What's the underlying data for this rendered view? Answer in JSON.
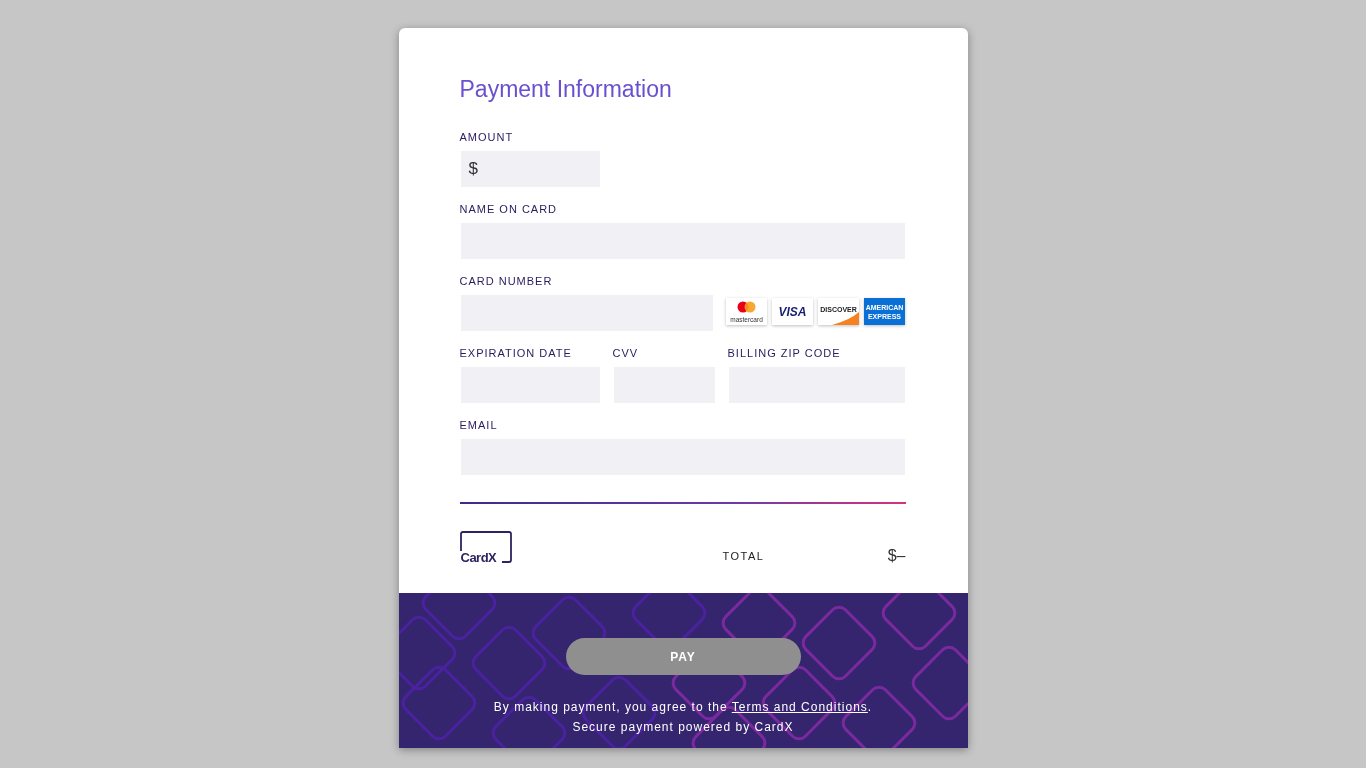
{
  "form": {
    "title": "Payment Information",
    "fields": [
      {
        "kind": "amount",
        "label": "AMOUNT",
        "prefix": "$"
      },
      {
        "kind": "full",
        "label": "NAME ON CARD"
      },
      {
        "kind": "card",
        "label": "CARD NUMBER"
      },
      {
        "kind": "exp",
        "label": "EXPIRATION DATE"
      },
      {
        "kind": "cvv",
        "label": "CVV"
      },
      {
        "kind": "zip",
        "label": "BILLING ZIP CODE"
      },
      {
        "kind": "full",
        "label": "EMAIL"
      }
    ],
    "card_logos": [
      {
        "kind": "mastercard",
        "text": "mastercard"
      },
      {
        "kind": "visa",
        "text": "VISA"
      },
      {
        "kind": "discover",
        "text": "DISCOVER"
      },
      {
        "kind": "amex",
        "text": "AMERICAN EXPRESS"
      }
    ]
  },
  "summary": {
    "logo": "CardX",
    "total_label": "TOTAL",
    "total_value": "$–"
  },
  "footer": {
    "pay_button": {
      "label": "PAY",
      "disabled": true
    },
    "agreement": "By making payment, you agree to the ",
    "terms_link": "Terms and Conditions",
    "agreement_end": ".",
    "powered_by": "Secure payment powered by CardX"
  }
}
